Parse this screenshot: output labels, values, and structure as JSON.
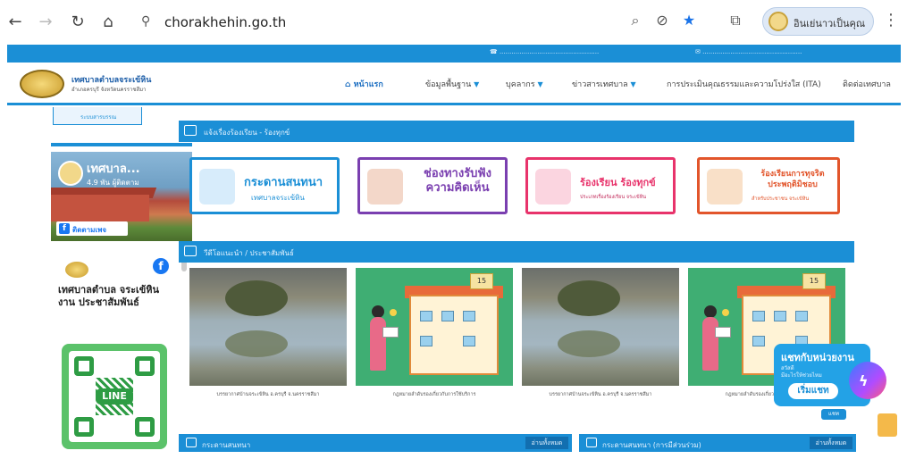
{
  "browser": {
    "url": "chorakhehin.go.th",
    "profile_label": "อินเย่นาวเป็นคุณ",
    "icons": [
      "back-icon",
      "forward-icon",
      "reload-icon",
      "home-icon",
      "site-settings-icon",
      "zoom-icon",
      "eye-off-icon",
      "star-icon",
      "extensions-icon",
      "menu-icon"
    ]
  },
  "header": {
    "org_name": "เทศบาลตำบลจระเข้หิน",
    "org_sub": "อำเภอครบุรี จังหวัดนครราชสีมา",
    "menu": [
      {
        "label": "หน้าแรก",
        "active": true
      },
      {
        "label": "ข้อมูลพื้นฐาน",
        "caret": true
      },
      {
        "label": "บุคลากร",
        "caret": true
      },
      {
        "label": "ข่าวสารเทศบาล",
        "caret": true
      },
      {
        "label": "การประเมินคุณธรรมและความโปร่งใส (ITA)"
      },
      {
        "label": "ติดต่อเทศบาล"
      }
    ]
  },
  "left": {
    "top_button": "ระบบสารบรรณ",
    "fb_title": "เทศบาล...",
    "fb_sub": "4.9 พัน ผู้ติดตาม",
    "fb_follow": "ติดตามเพจ",
    "post_text": "เทศบาลตำบล จระเข้หิน งาน ประชาสัมพันธ์",
    "qr_label": "LINE"
  },
  "sections": {
    "complaints": "แจ้งเรื่องร้องเรียน - ร้องทุกข์",
    "videos": "วีดีโอแนะนำ / ประชาสัมพันธ์",
    "bottom_left": "กระดานสนทนา",
    "bottom_right": "กระดานสนทนา (การมีส่วนร่วม)",
    "more": "อ่านทั้งหมด"
  },
  "banners": [
    {
      "title": "กระดานสนทนา",
      "sub": "เทศบาลจระเข้หิน",
      "color": "#1b8fd6"
    },
    {
      "title": "ช่องทางรับฟัง ความคิดเห็น",
      "sub": "",
      "color": "#7a3fb0"
    },
    {
      "title": "ร้องเรียน ร้องทุกข์",
      "sub": "ประเภทเรื่องร้องเรียน จระเข้หิน",
      "color": "#e8336b"
    },
    {
      "title": "ร้องเรียนการทุจริต ประพฤติมิชอบ",
      "sub": "สำหรับประชาชน จระเข้หิน",
      "color": "#e2552b"
    }
  ],
  "videos": [
    {
      "caption": "บรรยากาศบ้านจระเข้หิน อ.ครบุรี จ.นครราชสีมา",
      "kind": "photo"
    },
    {
      "caption": "กฎหมายลำดับรองเกี่ยวกับการใช้บริการ",
      "kind": "illus"
    },
    {
      "caption": "บรรยากาศบ้านจระเข้หิน อ.ครบุรี จ.นครราชสีมา",
      "kind": "photo"
    },
    {
      "caption": "กฎหมายลำดับรองเกี่ยวกับการใช้บริการ",
      "kind": "illus"
    }
  ],
  "chat": {
    "title": "แชทกับหน่วยงาน",
    "line1": "สวัสดี",
    "line2": "มีอะไรให้ช่วยไหม",
    "button": "เริ่มแชท",
    "badge": "แชท"
  },
  "colors": {
    "brand_blue": "#1b8fd6"
  }
}
